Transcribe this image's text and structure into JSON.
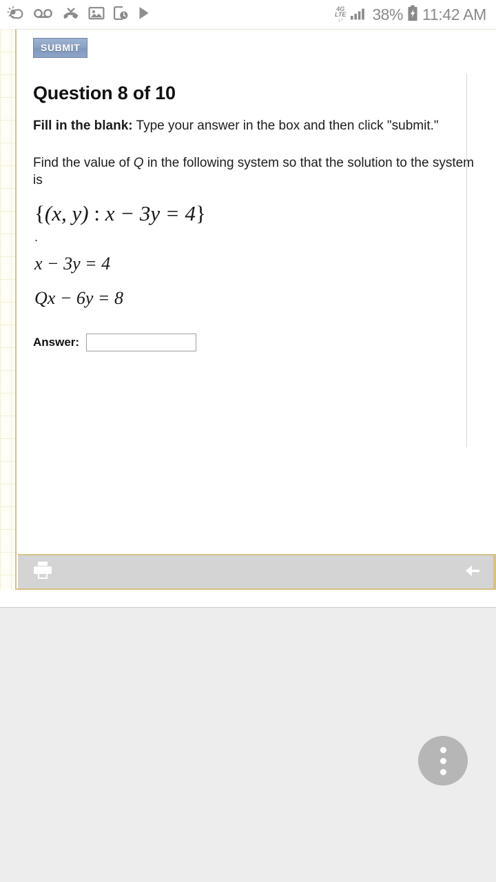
{
  "statusbar": {
    "icons_left": [
      {
        "name": "weather-icon",
        "label": "weather"
      },
      {
        "name": "voicemail-icon",
        "label": "voicemail"
      },
      {
        "name": "missed-call-icon",
        "label": "missed call"
      },
      {
        "name": "image-icon",
        "label": "screenshot saved"
      },
      {
        "name": "screen-timer-icon",
        "label": "screen recorder"
      },
      {
        "name": "play-store-icon",
        "label": "play store"
      }
    ],
    "network_type": "4G",
    "network_sub": "LTE",
    "network_arrows": "↓↑",
    "battery_percent": "38%",
    "battery_state": "charging",
    "time": "11:42 AM"
  },
  "page": {
    "submit_label": "SUBMIT",
    "title": "Question 8 of 10",
    "instruction_bold": "Fill in the blank:",
    "instruction_rest": " Type your answer in the box and then click \"submit.\"",
    "prompt_before": "Find the value of ",
    "prompt_variable": "Q",
    "prompt_after": " in the following system so that the solution to the system is",
    "solution_set": "{(x, y) : x − 3y = 4}",
    "solution_set_parts": {
      "open_brace": "{",
      "tuple": "(x, y)",
      "colon": " : ",
      "equation": "x − 3y = 4",
      "close_brace": "}"
    },
    "period": ".",
    "equation_1": "x − 3y = 4",
    "equation_2": "Qx − 6y = 8",
    "answer_label": "Answer:",
    "answer_value": "",
    "answer_placeholder": ""
  },
  "toolbar": {
    "print_label": "Print",
    "back_label": "Previous"
  },
  "fab": {
    "label": "More options"
  },
  "colors": {
    "submit_button": "#8ba2c4",
    "paper_border": "#d7c184",
    "toolbar_bg": "#d4d4d4",
    "fab_bg": "#b6b6b6",
    "page_bg": "#ededed",
    "status_text": "#8a8a8a"
  }
}
